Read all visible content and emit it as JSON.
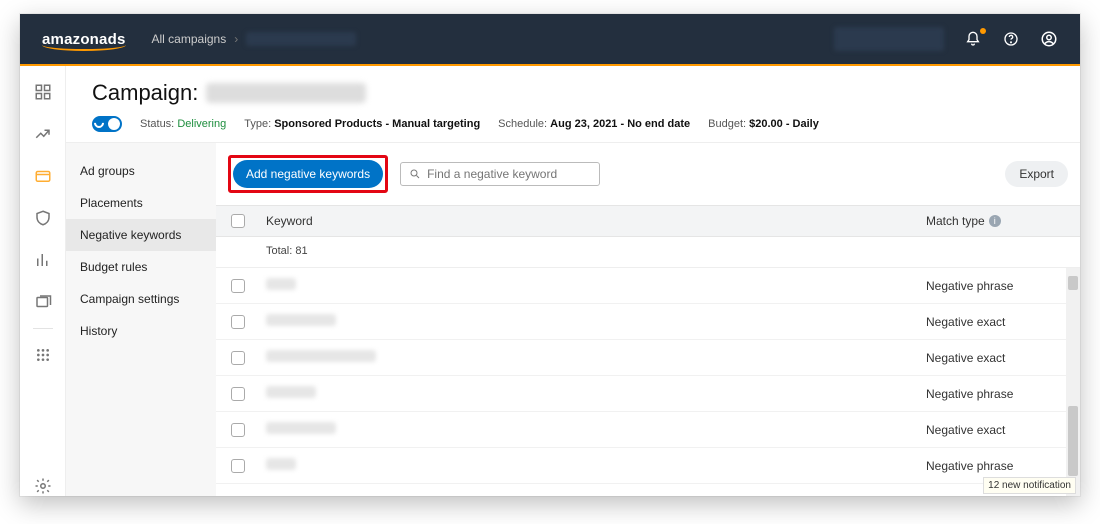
{
  "topbar": {
    "brand": "amazonads",
    "breadcrumb": "All campaigns"
  },
  "header": {
    "title_prefix": "Campaign:",
    "status_label": "Status:",
    "status_value": "Delivering",
    "type_label": "Type:",
    "type_value": "Sponsored Products - Manual targeting",
    "schedule_label": "Schedule:",
    "schedule_value": "Aug 23, 2021 - No end date",
    "budget_label": "Budget:",
    "budget_value": "$20.00 - Daily"
  },
  "subnav": {
    "items": [
      {
        "label": "Ad groups"
      },
      {
        "label": "Placements"
      },
      {
        "label": "Negative keywords",
        "active": true
      },
      {
        "label": "Budget rules"
      },
      {
        "label": "Campaign settings"
      },
      {
        "label": "History"
      }
    ]
  },
  "toolbar": {
    "add_button": "Add negative keywords",
    "search_placeholder": "Find a negative keyword",
    "export": "Export"
  },
  "table": {
    "col_keyword": "Keyword",
    "col_matchtype": "Match type",
    "total_label": "Total: 81",
    "rows": [
      {
        "mask_w": 30,
        "match": "Negative phrase"
      },
      {
        "mask_w": 70,
        "match": "Negative exact"
      },
      {
        "mask_w": 110,
        "match": "Negative exact"
      },
      {
        "mask_w": 50,
        "match": "Negative phrase"
      },
      {
        "mask_w": 70,
        "match": "Negative exact"
      },
      {
        "mask_w": 30,
        "match": "Negative phrase"
      }
    ]
  },
  "toast": "12 new notification"
}
